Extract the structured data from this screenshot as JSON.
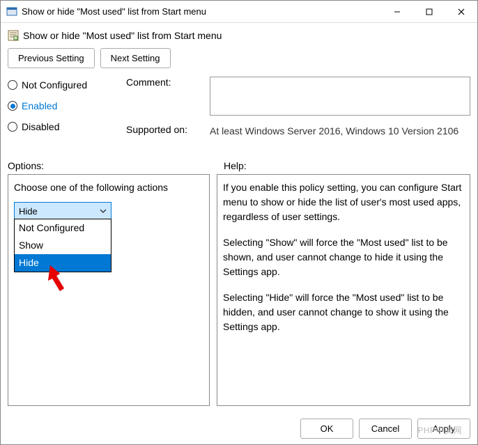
{
  "window": {
    "title": "Show or hide \"Most used\" list from Start menu"
  },
  "header": {
    "title": "Show or hide \"Most used\" list from Start menu"
  },
  "nav": {
    "previous": "Previous Setting",
    "next": "Next Setting"
  },
  "radios": {
    "not_configured": "Not Configured",
    "enabled": "Enabled",
    "disabled": "Disabled",
    "selected": "enabled"
  },
  "fields": {
    "comment_label": "Comment:",
    "comment_value": "",
    "supported_label": "Supported on:",
    "supported_value": "At least Windows Server 2016, Windows 10 Version 2106"
  },
  "panels": {
    "options_label": "Options:",
    "help_label": "Help:"
  },
  "options": {
    "instruction": "Choose one of the following actions",
    "selected": "Hide",
    "items": [
      "Not Configured",
      "Show",
      "Hide"
    ]
  },
  "help": {
    "p1": "If you enable this policy setting, you can configure Start menu to show or hide the list of user's most used apps, regardless of user settings.",
    "p2": "Selecting \"Show\" will force the \"Most used\" list to be shown, and user cannot change to hide it using the Settings app.",
    "p3": "Selecting \"Hide\" will force the \"Most used\" list to be hidden, and user cannot change to show it using the Settings app."
  },
  "footer": {
    "ok": "OK",
    "cancel": "Cancel",
    "apply": "Apply"
  },
  "watermark": "PHP中文网"
}
